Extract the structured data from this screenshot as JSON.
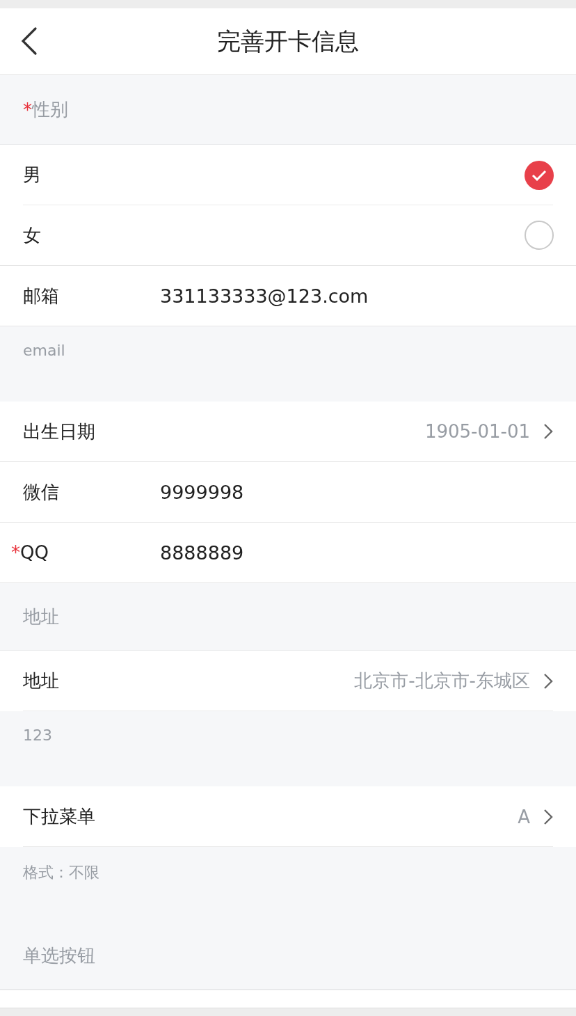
{
  "nav": {
    "title": "完善开卡信息"
  },
  "blocks": [
    {
      "kind": "header",
      "mark": "*",
      "label": "性别"
    },
    {
      "kind": "radio",
      "label": "男",
      "selected": true
    },
    {
      "kind": "radio",
      "label": "女",
      "selected": false
    },
    {
      "kind": "input",
      "label": "邮箱",
      "value": "331133333@123.com"
    },
    {
      "kind": "hint",
      "label": "email"
    },
    {
      "kind": "picker",
      "label": "出生日期",
      "value": "1905-01-01"
    },
    {
      "kind": "input",
      "label": "微信",
      "value": "9999998"
    },
    {
      "kind": "input",
      "mark": "*",
      "label": "QQ",
      "value": "8888889"
    },
    {
      "kind": "header",
      "label": "地址"
    },
    {
      "kind": "picker",
      "label": "地址",
      "value": "北京市-北京市-东城区"
    },
    {
      "kind": "hint",
      "label": "123"
    },
    {
      "kind": "picker",
      "label": "下拉菜单",
      "value": "A"
    },
    {
      "kind": "hint",
      "label": "格式：不限"
    },
    {
      "kind": "header",
      "label": "单选按钮"
    }
  ]
}
